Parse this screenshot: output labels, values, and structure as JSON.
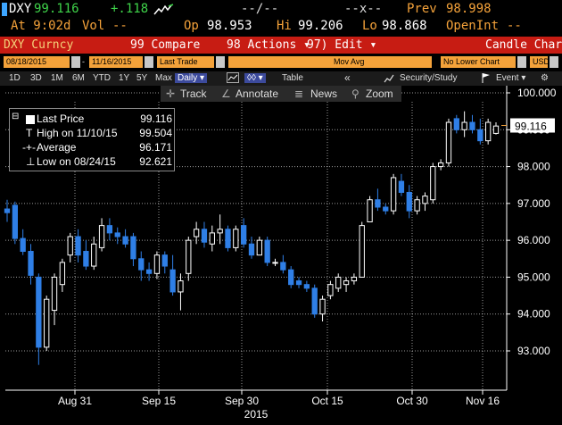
{
  "ticker": {
    "symbol": "DXY",
    "last": "99.116",
    "change": "+.118",
    "at": "At 9:02d",
    "vol_label": "Vol",
    "vol_value": "--",
    "mid1": "--/--",
    "mid2": "--x--",
    "prev_label": "Prev",
    "prev_value": "98.998",
    "op_label": "Op",
    "op_value": "98.953",
    "hi_label": "Hi",
    "hi_value": "99.206",
    "lo_label": "Lo",
    "lo_value": "98.868",
    "openint_label": "OpenInt",
    "openint_value": "--"
  },
  "menubar": {
    "left": "DXY Curncy",
    "compare": "99 Compare",
    "actions": "98 Actions ▾",
    "edit": "97) Edit ▾",
    "right": "Candle Chart"
  },
  "controls": {
    "start_date": "08/18/2015",
    "dash": "-",
    "end_date": "11/16/2015",
    "price_field": "Last Trade",
    "mov_avg": "Mov Avg",
    "lower_chart": "No Lower Chart",
    "currency": "USD"
  },
  "periods": {
    "items": [
      "1D",
      "3D",
      "1M",
      "6M",
      "YTD",
      "1Y",
      "5Y",
      "Max"
    ],
    "frequency": "Daily ▾",
    "table": "Table",
    "back": "«",
    "security_study": "Security/Study",
    "event": "Event ▾",
    "gear": "⚙"
  },
  "tools": {
    "track": "Track",
    "annotate": "Annotate",
    "news": "News",
    "zoom": "Zoom"
  },
  "legend": {
    "last_label": "Last Price",
    "last_value": "99.116",
    "high_label": "High on 11/10/15",
    "high_value": "99.504",
    "avg_label": "Average",
    "avg_value": "96.171",
    "low_label": "Low on 08/24/15",
    "low_value": "92.621"
  },
  "colors": {
    "up": "#ffffff",
    "down": "#2f7fe6",
    "grid": "#ffffff",
    "axis_text": "#ffffff"
  },
  "chart_data": {
    "type": "candlestick",
    "title": "",
    "y_ticks": [
      "100.000",
      "99.000",
      "98.000",
      "97.000",
      "96.000",
      "95.000",
      "94.000",
      "93.000"
    ],
    "x_ticks": [
      "Aug 31",
      "Sep 15",
      "Sep 30",
      "Oct 15",
      "Oct 30",
      "Nov 16"
    ],
    "x_sublabel": "2015",
    "ylim": [
      92.0,
      100.3
    ],
    "last_marker": "99.116",
    "candles": [
      {
        "o": 96.85,
        "h": 97.1,
        "l": 96.5,
        "c": 96.75
      },
      {
        "o": 96.95,
        "h": 97.05,
        "l": 95.9,
        "c": 96.05
      },
      {
        "o": 96.05,
        "h": 96.3,
        "l": 95.6,
        "c": 95.7
      },
      {
        "o": 95.7,
        "h": 95.9,
        "l": 94.8,
        "c": 95.05
      },
      {
        "o": 95.0,
        "h": 95.1,
        "l": 92.62,
        "c": 93.1
      },
      {
        "o": 93.1,
        "h": 94.5,
        "l": 93.0,
        "c": 94.4
      },
      {
        "o": 94.1,
        "h": 95.1,
        "l": 93.7,
        "c": 95.0
      },
      {
        "o": 94.8,
        "h": 95.5,
        "l": 94.6,
        "c": 95.4
      },
      {
        "o": 95.6,
        "h": 96.2,
        "l": 95.4,
        "c": 96.1
      },
      {
        "o": 96.1,
        "h": 96.3,
        "l": 95.4,
        "c": 95.6
      },
      {
        "o": 95.7,
        "h": 96.0,
        "l": 95.2,
        "c": 95.3
      },
      {
        "o": 95.3,
        "h": 96.1,
        "l": 95.2,
        "c": 95.9
      },
      {
        "o": 95.8,
        "h": 96.6,
        "l": 95.7,
        "c": 96.4
      },
      {
        "o": 96.4,
        "h": 96.6,
        "l": 96.0,
        "c": 96.2
      },
      {
        "o": 96.2,
        "h": 96.35,
        "l": 95.9,
        "c": 96.1
      },
      {
        "o": 96.1,
        "h": 96.3,
        "l": 95.8,
        "c": 95.9
      },
      {
        "o": 96.1,
        "h": 96.2,
        "l": 95.3,
        "c": 95.5
      },
      {
        "o": 95.5,
        "h": 95.7,
        "l": 94.9,
        "c": 95.2
      },
      {
        "o": 95.2,
        "h": 95.4,
        "l": 94.9,
        "c": 95.1
      },
      {
        "o": 95.1,
        "h": 95.7,
        "l": 94.95,
        "c": 95.6
      },
      {
        "o": 95.6,
        "h": 95.7,
        "l": 95.1,
        "c": 95.3
      },
      {
        "o": 95.2,
        "h": 95.6,
        "l": 94.5,
        "c": 94.6
      },
      {
        "o": 94.6,
        "h": 95.1,
        "l": 94.1,
        "c": 94.9
      },
      {
        "o": 95.1,
        "h": 96.1,
        "l": 94.9,
        "c": 96.0
      },
      {
        "o": 96.1,
        "h": 96.5,
        "l": 95.9,
        "c": 96.3
      },
      {
        "o": 96.3,
        "h": 96.5,
        "l": 95.8,
        "c": 95.95
      },
      {
        "o": 95.9,
        "h": 96.4,
        "l": 95.7,
        "c": 96.2
      },
      {
        "o": 96.2,
        "h": 96.7,
        "l": 95.9,
        "c": 96.3
      },
      {
        "o": 96.3,
        "h": 96.4,
        "l": 95.7,
        "c": 95.8
      },
      {
        "o": 95.8,
        "h": 96.4,
        "l": 95.7,
        "c": 96.3
      },
      {
        "o": 96.4,
        "h": 96.6,
        "l": 95.8,
        "c": 95.9
      },
      {
        "o": 95.9,
        "h": 96.1,
        "l": 95.5,
        "c": 95.6
      },
      {
        "o": 95.6,
        "h": 96.1,
        "l": 95.6,
        "c": 96.0
      },
      {
        "o": 96.0,
        "h": 96.1,
        "l": 95.3,
        "c": 95.4
      },
      {
        "o": 95.4,
        "h": 95.5,
        "l": 95.3,
        "c": 95.4
      },
      {
        "o": 95.4,
        "h": 95.6,
        "l": 95.1,
        "c": 95.2
      },
      {
        "o": 95.2,
        "h": 95.3,
        "l": 94.7,
        "c": 94.8
      },
      {
        "o": 94.9,
        "h": 95.0,
        "l": 94.7,
        "c": 94.8
      },
      {
        "o": 94.8,
        "h": 94.9,
        "l": 94.6,
        "c": 94.7
      },
      {
        "o": 94.7,
        "h": 94.8,
        "l": 93.9,
        "c": 94.0
      },
      {
        "o": 94.0,
        "h": 94.5,
        "l": 93.8,
        "c": 94.4
      },
      {
        "o": 94.5,
        "h": 94.9,
        "l": 94.4,
        "c": 94.8
      },
      {
        "o": 94.7,
        "h": 95.1,
        "l": 94.6,
        "c": 95.0
      },
      {
        "o": 94.8,
        "h": 95.0,
        "l": 94.6,
        "c": 94.9
      },
      {
        "o": 94.9,
        "h": 95.1,
        "l": 94.8,
        "c": 95.0
      },
      {
        "o": 95.0,
        "h": 96.5,
        "l": 95.0,
        "c": 96.4
      },
      {
        "o": 96.5,
        "h": 97.2,
        "l": 96.5,
        "c": 97.1
      },
      {
        "o": 97.1,
        "h": 97.4,
        "l": 96.8,
        "c": 96.9
      },
      {
        "o": 96.9,
        "h": 97.0,
        "l": 96.7,
        "c": 96.8
      },
      {
        "o": 96.8,
        "h": 97.8,
        "l": 96.7,
        "c": 97.7
      },
      {
        "o": 97.6,
        "h": 97.8,
        "l": 97.2,
        "c": 97.3
      },
      {
        "o": 97.3,
        "h": 97.5,
        "l": 96.6,
        "c": 96.8
      },
      {
        "o": 96.8,
        "h": 97.2,
        "l": 96.7,
        "c": 97.1
      },
      {
        "o": 97.0,
        "h": 97.3,
        "l": 96.8,
        "c": 97.2
      },
      {
        "o": 97.1,
        "h": 98.1,
        "l": 97.0,
        "c": 98.0
      },
      {
        "o": 98.0,
        "h": 98.2,
        "l": 97.9,
        "c": 98.1
      },
      {
        "o": 98.1,
        "h": 99.3,
        "l": 98.0,
        "c": 99.2
      },
      {
        "o": 99.3,
        "h": 99.4,
        "l": 98.9,
        "c": 99.0
      },
      {
        "o": 99.0,
        "h": 99.5,
        "l": 98.8,
        "c": 99.2
      },
      {
        "o": 99.2,
        "h": 99.4,
        "l": 98.9,
        "c": 99.0
      },
      {
        "o": 99.0,
        "h": 99.3,
        "l": 98.6,
        "c": 98.7
      },
      {
        "o": 98.7,
        "h": 99.3,
        "l": 98.6,
        "c": 99.2
      },
      {
        "o": 98.9,
        "h": 99.2,
        "l": 98.87,
        "c": 99.1
      }
    ]
  }
}
